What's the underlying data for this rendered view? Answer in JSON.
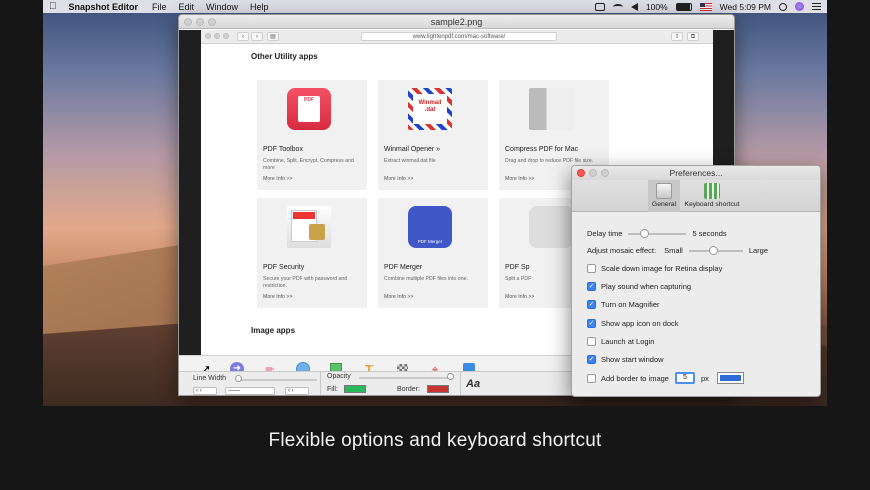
{
  "menubar": {
    "app_name": "Snapshot Editor",
    "menus": [
      "File",
      "Edit",
      "Window",
      "Help"
    ],
    "battery": "100%",
    "clock": "Wed 5:09 PM"
  },
  "main_window": {
    "title": "sample2.png",
    "browser": {
      "url": "www.lightenpdf.com/mac-software/",
      "section_1": "Other Utility apps",
      "section_2": "Image apps",
      "cards": [
        {
          "name": "PDF Toolbox",
          "desc": "Combine, Split, Encrypt, Compress and more",
          "more": "More Info >>",
          "color": "#e8384f"
        },
        {
          "name": "Winmail Opener »",
          "desc": "Extract winmail.dat file",
          "more": "More Info >>",
          "color": "#ffffff"
        },
        {
          "name": "Compress PDF for Mac",
          "desc": "Drag and drop to reduce PDF file size.",
          "more": "More Info >>",
          "color": "#dddddd"
        },
        {
          "name": "PDF Security",
          "desc": "Secure your PDF with password and restriction.",
          "more": "More Info >>",
          "color": "#f4f4f4"
        },
        {
          "name": "PDF Merger",
          "desc": "Combine multiple PDF files into one.",
          "more": "More Info >>",
          "color": "#3f57c7"
        },
        {
          "name": "PDF Sp",
          "desc": "Split a PDF",
          "more": "More Info >>",
          "color": "#dddddd"
        }
      ],
      "thumb_labels": {
        "toolbox": "PDF",
        "winmail": "Winmail .dat",
        "merger": "PDF Merger"
      }
    },
    "tool_options": {
      "line_width_label": "Line Width",
      "opacity_label": "Opacity",
      "fill_label": "Fill:",
      "border_label": "Border:",
      "fill_color": "#29b85a",
      "border_color": "#c8342f",
      "font_sample": "Aa"
    }
  },
  "preferences": {
    "title": "Preferences...",
    "tabs": [
      "General",
      "Keyboard shortcut"
    ],
    "delay_label": "Delay time",
    "delay_value": "5 seconds",
    "mosaic_label": "Adjust mosaic effect:",
    "mosaic_small": "Small",
    "mosaic_large": "Large",
    "options": [
      {
        "label": "Scale down image for Retina display",
        "checked": false
      },
      {
        "label": "Play sound when capturing",
        "checked": true
      },
      {
        "label": "Turn on Magnifier",
        "checked": true
      },
      {
        "label": "Show app icon on dock",
        "checked": true
      },
      {
        "label": "Launch at Login",
        "checked": false
      },
      {
        "label": "Show start window",
        "checked": true
      }
    ],
    "border_label": "Add border to image",
    "border_checked": false,
    "border_value": "5",
    "border_unit": "px",
    "border_color": "#2f6bd8"
  },
  "caption": "Flexible options and keyboard shortcut"
}
